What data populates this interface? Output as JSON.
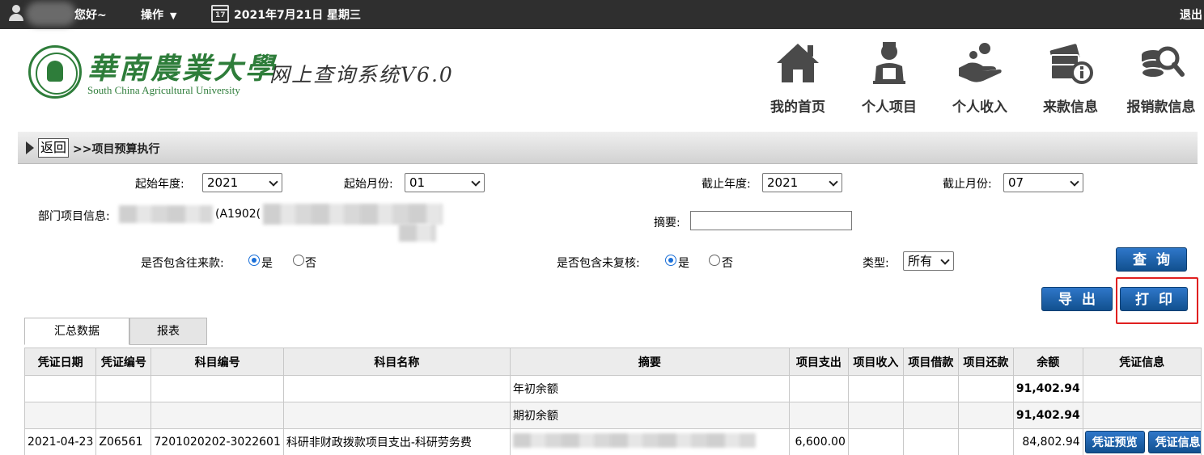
{
  "topbar": {
    "greeting": "您好~",
    "operations": "操作",
    "operations_caret": "▼",
    "date": "2021年7月21日 星期三",
    "calendar_day": "17",
    "logout": "退出"
  },
  "header": {
    "school_name_cn": "華南農業大學",
    "school_name_en": "South China Agricultural University",
    "system_title": "网上查询系统V6.0"
  },
  "nav": {
    "items": [
      {
        "label": "我的首页",
        "icon": "house-icon"
      },
      {
        "label": "个人项目",
        "icon": "person-icon"
      },
      {
        "label": "个人收入",
        "icon": "hand-coin-icon"
      },
      {
        "label": "来款信息",
        "icon": "money-info-icon"
      },
      {
        "label": "报销款信息",
        "icon": "coins-search-icon"
      }
    ]
  },
  "breadcrumb": {
    "back": "返回",
    "path": ">>项目预算执行"
  },
  "form": {
    "start_year_label": "起始年度:",
    "start_year": "2021",
    "start_month_label": "起始月份:",
    "start_month": "01",
    "end_year_label": "截止年度:",
    "end_year": "2021",
    "end_month_label": "截止月份:",
    "end_month": "07",
    "dept_project_label": "部门项目信息:",
    "dept_project_code": "(A1902(",
    "summary_label": "摘要:",
    "summary_value": "",
    "include_transfers_label": "是否包含往来款:",
    "include_unreviewed_label": "是否包含未复核:",
    "yes": "是",
    "no": "否",
    "type_label": "类型:",
    "type_value": "所有"
  },
  "buttons": {
    "query": "查询",
    "export": "导出",
    "print": "打印"
  },
  "tabs": [
    {
      "label": "汇总数据",
      "active": true
    },
    {
      "label": "报表",
      "active": false
    }
  ],
  "table": {
    "headers": [
      "凭证日期",
      "凭证编号",
      "科目编号",
      "科目名称",
      "摘要",
      "项目支出",
      "项目收入",
      "项目借款",
      "项目还款",
      "余额",
      "凭证信息"
    ],
    "rows": [
      {
        "date": "",
        "voucher": "",
        "subject_code": "",
        "subject_name": "",
        "summary": "年初余额",
        "expense": "",
        "income": "",
        "loan": "",
        "repay": "",
        "balance": "91,402.94"
      },
      {
        "date": "",
        "voucher": "",
        "subject_code": "",
        "subject_name": "",
        "summary": "期初余额",
        "expense": "",
        "income": "",
        "loan": "",
        "repay": "",
        "balance": "91,402.94"
      },
      {
        "date": "2021-04-23",
        "voucher": "Z06561",
        "subject_code": "7201020202-3022601",
        "subject_name": "科研非财政拨款项目支出-科研劳务费",
        "summary": "",
        "expense": "6,600.00",
        "income": "",
        "loan": "",
        "repay": "",
        "balance": "84,802.94",
        "btn_preview": "凭证预览",
        "btn_info": "凭证信息"
      }
    ]
  },
  "colors": {
    "topbar_bg": "#2f2f2f",
    "logo_green": "#2e7d3a",
    "button_blue": "#1a5fa8",
    "highlight_red": "#e02020"
  }
}
